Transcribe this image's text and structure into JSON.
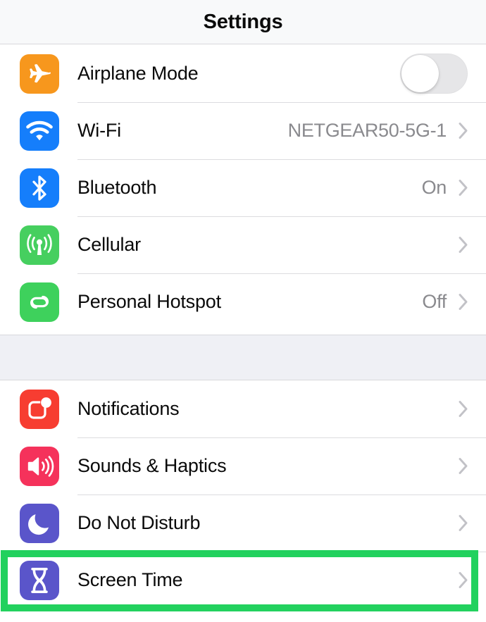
{
  "navbar": {
    "title": "Settings"
  },
  "groups": [
    {
      "id": "group-1",
      "rows": [
        {
          "label": "Airplane Mode",
          "icon": "airplane-icon",
          "icon_color": "#f7971d",
          "accessory": "toggle",
          "toggle_on": false,
          "value": ""
        },
        {
          "label": "Wi-Fi",
          "icon": "wifi-icon",
          "icon_color": "#157efb",
          "accessory": "chevron",
          "value": "NETGEAR50-5G-1"
        },
        {
          "label": "Bluetooth",
          "icon": "bluetooth-icon",
          "icon_color": "#157efb",
          "accessory": "chevron",
          "value": "On"
        },
        {
          "label": "Cellular",
          "icon": "cellular-antenna-icon",
          "icon_color": "#46cf5f",
          "accessory": "chevron",
          "value": ""
        },
        {
          "label": "Personal Hotspot",
          "icon": "hotspot-links-icon",
          "icon_color": "#3ed15c",
          "accessory": "chevron",
          "value": "Off"
        }
      ]
    },
    {
      "id": "group-2",
      "rows": [
        {
          "label": "Notifications",
          "icon": "notifications-badge-icon",
          "icon_color": "#f73d31",
          "accessory": "chevron",
          "value": ""
        },
        {
          "label": "Sounds & Haptics",
          "icon": "speaker-icon",
          "icon_color": "#f5325b",
          "accessory": "chevron",
          "value": ""
        },
        {
          "label": "Do Not Disturb",
          "icon": "moon-icon",
          "icon_color": "#5a55ca",
          "accessory": "chevron",
          "value": ""
        },
        {
          "label": "Screen Time",
          "icon": "hourglass-icon",
          "icon_color": "#5a55ca",
          "accessory": "chevron",
          "value": ""
        }
      ]
    }
  ],
  "highlight": {
    "target_label": "Screen Time",
    "color": "#22d15e"
  },
  "colors": {
    "separator": "#dcdcdf",
    "group_gap": "#eff0f5",
    "navbar_bg": "#f8f9fa",
    "value_text": "#8a8a8e",
    "chevron": "#c2c2c7"
  }
}
